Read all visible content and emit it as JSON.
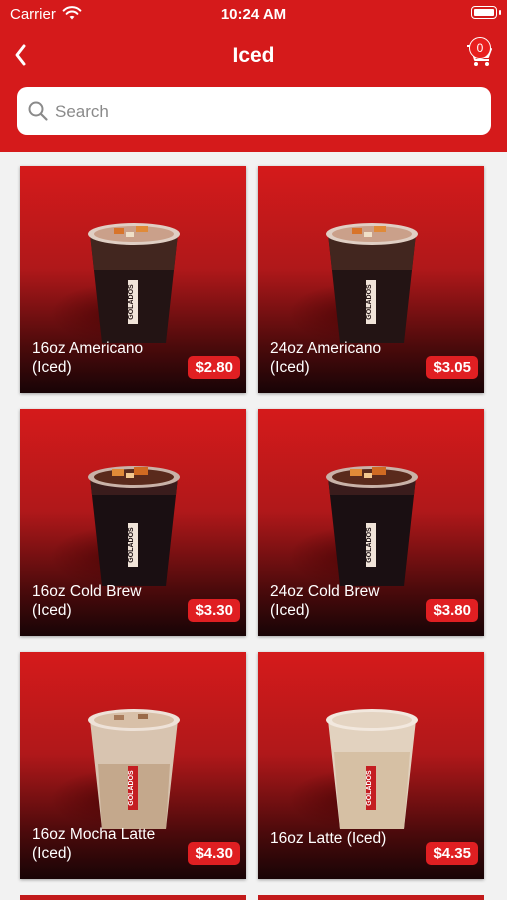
{
  "status": {
    "carrier": "Carrier",
    "time": "10:24 AM"
  },
  "nav": {
    "title": "Iced",
    "cart_count": "0"
  },
  "search": {
    "placeholder": "Search"
  },
  "colors": {
    "brand_red": "#d51a1b",
    "badge_red": "#e01f22"
  },
  "products": [
    {
      "name": "16oz Americano (Iced)",
      "price": "$2.80",
      "drink": "americano"
    },
    {
      "name": "24oz Americano (Iced)",
      "price": "$3.05",
      "drink": "americano"
    },
    {
      "name": "16oz Cold Brew (Iced)",
      "price": "$3.30",
      "drink": "cold-brew"
    },
    {
      "name": "24oz Cold Brew (Iced)",
      "price": "$3.80",
      "drink": "cold-brew"
    },
    {
      "name": "16oz Mocha Latte (Iced)",
      "price": "$4.30",
      "drink": "latte"
    },
    {
      "name": "16oz Latte (Iced)",
      "price": "$4.35",
      "drink": "latte"
    }
  ],
  "icons": {
    "back": "chevron-left-icon",
    "cart": "cart-icon",
    "search": "search-icon",
    "wifi": "wifi-icon",
    "battery": "battery-icon"
  }
}
